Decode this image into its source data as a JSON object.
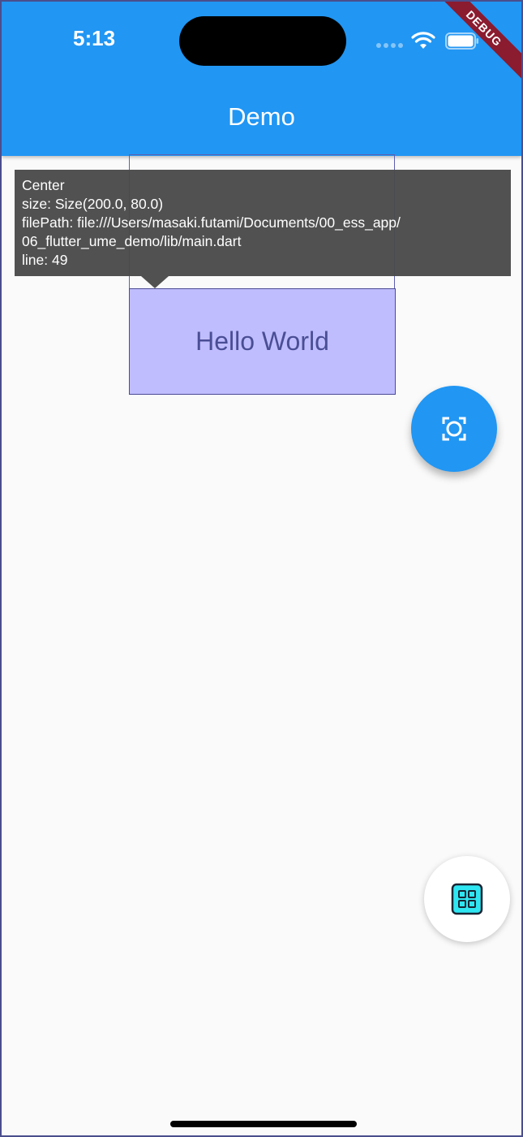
{
  "status_bar": {
    "time": "5:13",
    "debug_label": "DEBUG"
  },
  "appbar": {
    "title": "Demo"
  },
  "inspector_tooltip": {
    "lines": [
      "Center",
      "size: Size(200.0, 80.0)",
      "filePath: file:///Users/masaki.futami/Documents/00_ess_app/",
      "06_flutter_ume_demo/lib/main.dart",
      "line: 49"
    ]
  },
  "body": {
    "text": "Hello World"
  },
  "icons": {
    "inspect_fab": "center-focus-icon",
    "ume_fab": "grid-widget-icon"
  },
  "colors": {
    "primary": "#2196f3",
    "highlight": "#c0bdff",
    "tooltip_bg": "#4a4a4a",
    "debug_ribbon": "#8b1b2f"
  }
}
